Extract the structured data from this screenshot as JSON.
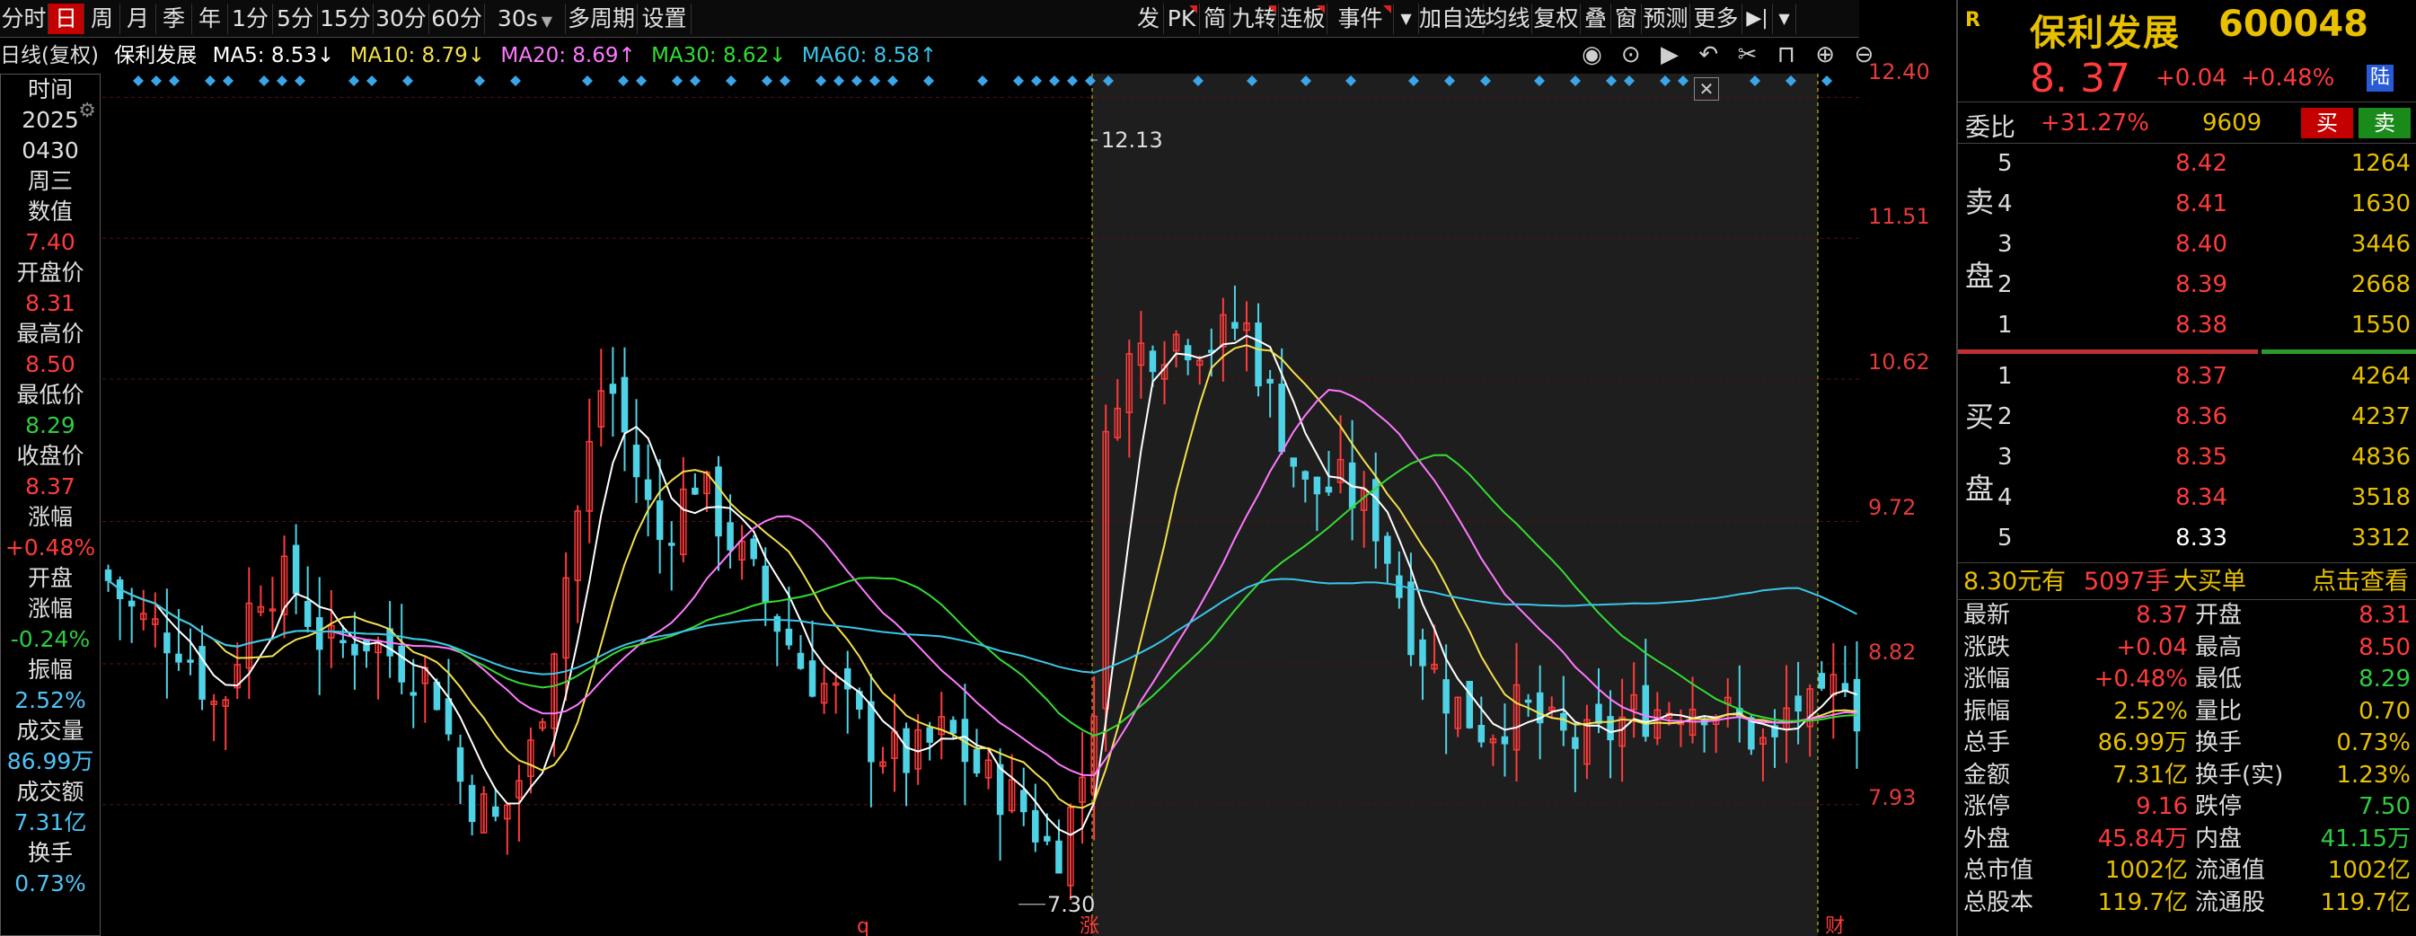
{
  "toolbar": {
    "left_items": [
      "分时",
      "日",
      "周",
      "月",
      "季",
      "年",
      "1分",
      "5分",
      "15分",
      "30分",
      "60分",
      "30s",
      "多周期",
      "设置"
    ],
    "active": "日",
    "right_items": [
      "发",
      "PK",
      "简",
      "九转",
      "连板",
      "事件",
      "加自选",
      "均线",
      "复权",
      "叠",
      "窗",
      "预测",
      "更多"
    ]
  },
  "ma_bar": {
    "label": "日线(复权)",
    "name": "保利发展",
    "ma5": "MA5: 8.53↓",
    "ma10": "MA10: 8.79↓",
    "ma20": "MA20: 8.69↑",
    "ma30": "MA30: 8.62↓",
    "ma60": "MA60: 8.58↑"
  },
  "left_panel": [
    {
      "text": "时间",
      "color": "#e0e0e0"
    },
    {
      "text": "2025",
      "color": "#e0e0e0"
    },
    {
      "text": "0430",
      "color": "#e0e0e0"
    },
    {
      "text": "周三",
      "color": "#e0e0e0"
    },
    {
      "text": "数值",
      "color": "#e0e0e0"
    },
    {
      "text": "7.40",
      "color": "#ff3b3b"
    },
    {
      "text": "开盘价",
      "color": "#e0e0e0"
    },
    {
      "text": "8.31",
      "color": "#ff3b3b"
    },
    {
      "text": "最高价",
      "color": "#e0e0e0"
    },
    {
      "text": "8.50",
      "color": "#ff3b3b"
    },
    {
      "text": "最低价",
      "color": "#e0e0e0"
    },
    {
      "text": "8.29",
      "color": "#2ecc40"
    },
    {
      "text": "收盘价",
      "color": "#e0e0e0"
    },
    {
      "text": "8.37",
      "color": "#ff3b3b"
    },
    {
      "text": "涨幅",
      "color": "#e0e0e0"
    },
    {
      "text": "+0.48%",
      "color": "#ff3b3b"
    },
    {
      "text": "开盘",
      "color": "#e0e0e0"
    },
    {
      "text": "涨幅",
      "color": "#e0e0e0"
    },
    {
      "text": "-0.24%",
      "color": "#2ecc40"
    },
    {
      "text": "振幅",
      "color": "#e0e0e0"
    },
    {
      "text": "2.52%",
      "color": "#4fc3f7"
    },
    {
      "text": "成交量",
      "color": "#e0e0e0"
    },
    {
      "text": "86.99万",
      "color": "#4fc3f7"
    },
    {
      "text": "成交额",
      "color": "#e0e0e0"
    },
    {
      "text": "7.31亿",
      "color": "#4fc3f7"
    },
    {
      "text": "换手",
      "color": "#e0e0e0"
    },
    {
      "text": "0.73%",
      "color": "#4fc3f7"
    }
  ],
  "price_axis": [
    "12.40",
    "11.51",
    "10.62",
    "9.72",
    "8.82",
    "7.93"
  ],
  "annotations": {
    "high": "12.13",
    "low": "7.30",
    "marker_q": "q",
    "marker_zhang": "涨",
    "marker_cai": "财"
  },
  "quote": {
    "badge": "R",
    "name": "保利发展",
    "code": "600048",
    "price": "8. 37",
    "change": "+0.04",
    "change_pct": "+0.48%",
    "exchange": "陆",
    "weibi_label": "委比",
    "weibi_value": "+31.27%",
    "weibi_diff": "9609",
    "buy_label": "买",
    "sell_label": "卖"
  },
  "order_book": {
    "sell_side_label": [
      "卖",
      "盘"
    ],
    "buy_side_label": [
      "买",
      "盘"
    ],
    "asks": [
      {
        "level": "5",
        "price": "8.42",
        "vol": "1264"
      },
      {
        "level": "4",
        "price": "8.41",
        "vol": "1630"
      },
      {
        "level": "3",
        "price": "8.40",
        "vol": "3446"
      },
      {
        "level": "2",
        "price": "8.39",
        "vol": "2668"
      },
      {
        "level": "1",
        "price": "8.38",
        "vol": "1550"
      }
    ],
    "bids": [
      {
        "level": "1",
        "price": "8.37",
        "vol": "4264"
      },
      {
        "level": "2",
        "price": "8.36",
        "vol": "4237"
      },
      {
        "level": "3",
        "price": "8.35",
        "vol": "4836"
      },
      {
        "level": "4",
        "price": "8.34",
        "vol": "3518"
      },
      {
        "level": "5",
        "price": "8.33",
        "vol": "3312"
      }
    ]
  },
  "big_order": {
    "price": "8.30元有",
    "qty": "5097手",
    "type": "大买单",
    "action": "点击查看"
  },
  "stats": [
    {
      "k1": "最新",
      "v1": "8.37",
      "c1": "#ff3b3b",
      "k2": "开盘",
      "v2": "8.31",
      "c2": "#ff3b3b"
    },
    {
      "k1": "涨跌",
      "v1": "+0.04",
      "c1": "#ff3b3b",
      "k2": "最高",
      "v2": "8.50",
      "c2": "#ff3b3b"
    },
    {
      "k1": "涨幅",
      "v1": "+0.48%",
      "c1": "#ff3b3b",
      "k2": "最低",
      "v2": "8.29",
      "c2": "#2ecc40"
    },
    {
      "k1": "振幅",
      "v1": "2.52%",
      "c1": "#e8c000",
      "k2": "量比",
      "v2": "0.70",
      "c2": "#e8c000"
    },
    {
      "k1": "总手",
      "v1": "86.99万",
      "c1": "#e8c000",
      "k2": "换手",
      "v2": "0.73%",
      "c2": "#e8c000"
    },
    {
      "k1": "金额",
      "v1": "7.31亿",
      "c1": "#e8c000",
      "k2": "换手(实)",
      "v2": "1.23%",
      "c2": "#e8c000"
    },
    {
      "k1": "涨停",
      "v1": "9.16",
      "c1": "#ff3b3b",
      "k2": "跌停",
      "v2": "7.50",
      "c2": "#2ecc40"
    },
    {
      "k1": "外盘",
      "v1": "45.84万",
      "c1": "#ff3b3b",
      "k2": "内盘",
      "v2": "41.15万",
      "c2": "#2ecc40"
    },
    {
      "k1": "总市值",
      "v1": "1002亿",
      "c1": "#e8c000",
      "k2": "流通值",
      "v2": "1002亿",
      "c2": "#e8c000"
    },
    {
      "k1": "总股本",
      "v1": "119.7亿",
      "c1": "#e8c000",
      "k2": "流通股",
      "v2": "119.7亿",
      "c2": "#e8c000"
    }
  ],
  "colors": {
    "up": "#ff3b3b",
    "down": "#4fd2e6",
    "ma5": "#ffffff",
    "ma10": "#f4e04d",
    "ma20": "#ff79ff",
    "ma30": "#33dd33",
    "ma60": "#3ac6e8",
    "signal": "#3aa6e8"
  }
}
